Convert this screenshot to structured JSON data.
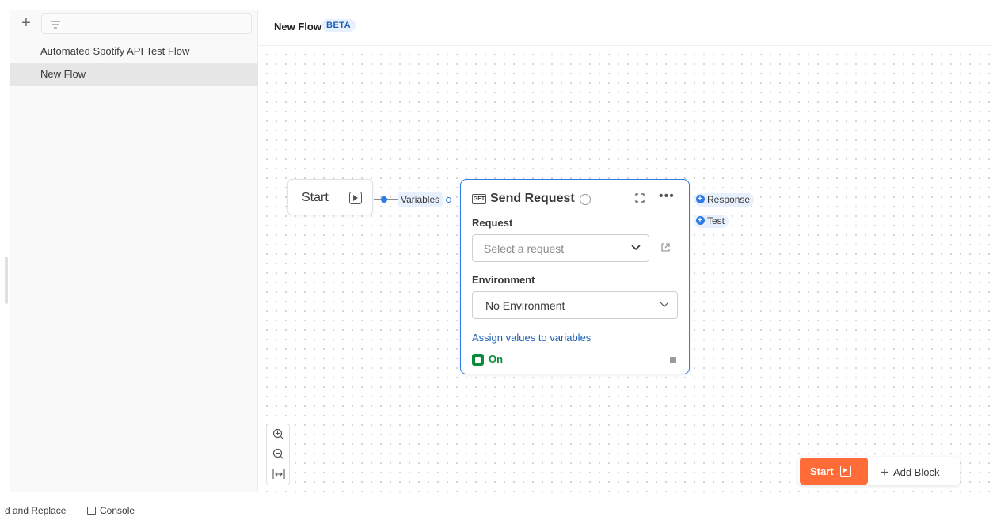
{
  "sidebar": {
    "items": [
      {
        "label": "Automated Spotify API Test Flow",
        "active": false
      },
      {
        "label": "New Flow",
        "active": true
      }
    ]
  },
  "header": {
    "title": "New Flow",
    "badge": "BETA"
  },
  "canvas": {
    "start_node": {
      "label": "Start"
    },
    "variables_chip": "Variables",
    "send_request": {
      "method_badge": "GET",
      "title": "Send Request",
      "request_label": "Request",
      "request_placeholder": "Select a request",
      "environment_label": "Environment",
      "environment_value": "No Environment",
      "assign_link": "Assign values to variables",
      "status": "On"
    },
    "outputs": [
      "Response",
      "Test"
    ]
  },
  "toolbar": {
    "start_label": "Start",
    "add_block_label": "Add Block"
  },
  "footer": {
    "find_replace": "d and Replace",
    "console": "Console"
  },
  "colors": {
    "accent": "#2d7be5",
    "start_button": "#ff6c37",
    "on_green": "#0b8a3a"
  }
}
